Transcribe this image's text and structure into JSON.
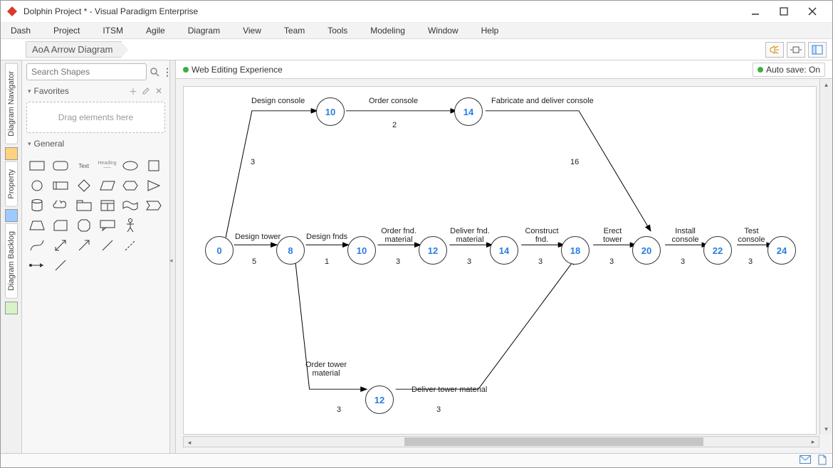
{
  "window": {
    "title": "Dolphin Project * - Visual Paradigm Enterprise"
  },
  "menu": [
    "Dash",
    "Project",
    "ITSM",
    "Agile",
    "Diagram",
    "View",
    "Team",
    "Tools",
    "Modeling",
    "Window",
    "Help"
  ],
  "breadcrumb": "AoA Arrow Diagram",
  "side_tabs": [
    "Diagram Navigator",
    "Property",
    "Diagram Backlog"
  ],
  "shapes_panel": {
    "search_placeholder": "Search Shapes",
    "favorites_header": "Favorites",
    "drop_hint": "Drag elements here",
    "general_header": "General"
  },
  "canvas_toolbar": {
    "left_status": "Web Editing Experience",
    "auto_save": "Auto save: On"
  },
  "diagram": {
    "nodes": {
      "n0": "0",
      "n8": "8",
      "n10m": "10",
      "n12m": "12",
      "n14m": "14",
      "n18": "18",
      "n20": "20",
      "n22": "22",
      "n24": "24",
      "n10t": "10",
      "n14t": "14",
      "n12b": "12"
    },
    "edge_labels": {
      "design_console": "Design console",
      "order_console": "Order console",
      "fab_deliver_console": "Fabricate and deliver console",
      "design_tower": "Design tower",
      "design_fnds": "Design fnds",
      "order_fnd_mat": "Order fnd. material",
      "deliver_fnd_mat": "Deliver fnd. material",
      "construct_fnd": "Construct fnd.",
      "erect_tower": "Erect tower",
      "install_console": "Install console",
      "test_console": "Test console",
      "order_tower_mat": "Order tower material",
      "deliver_tower_mat": "Deliver tower material"
    },
    "edge_durations": {
      "d_top1": "3",
      "d_top2": "2",
      "d_top3": "16",
      "d_m1": "5",
      "d_m2": "1",
      "d_m3": "3",
      "d_m4": "3",
      "d_m5": "3",
      "d_m6": "3",
      "d_m7": "3",
      "d_m8": "3",
      "d_bot1": "3",
      "d_bot2": "3"
    }
  }
}
